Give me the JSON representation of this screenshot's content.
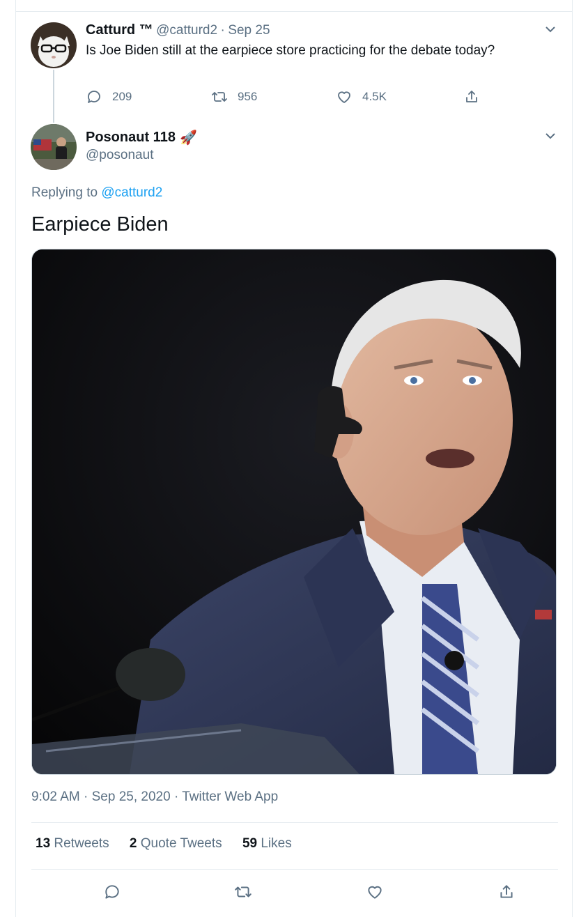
{
  "parent_tweet": {
    "name": "Catturd ™",
    "handle": "@catturd2",
    "sep": "·",
    "date": "Sep 25",
    "text": "Is Joe Biden still at the earpiece store practicing for the debate today?",
    "reply_count": "209",
    "retweet_count": "956",
    "like_count": "4.5K"
  },
  "main_tweet": {
    "name": "Posonaut 118",
    "name_emoji": "🚀",
    "handle": "@posonaut",
    "replying_prefix": "Replying to",
    "replying_to": "@catturd2",
    "text": "Earpiece Biden",
    "time": "9:02 AM",
    "sep": "·",
    "date": "Sep 25, 2020",
    "source": "Twitter Web App",
    "stats": {
      "retweets_count": "13",
      "retweets_label": "Retweets",
      "quotes_count": "2",
      "quotes_label": "Quote Tweets",
      "likes_count": "59",
      "likes_label": "Likes"
    }
  },
  "colors": {
    "accent": "#1da1f2",
    "muted": "#5b7083",
    "border": "#e6ecf0"
  }
}
